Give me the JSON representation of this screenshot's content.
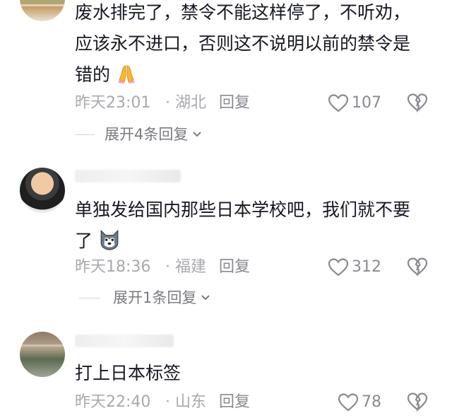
{
  "comments": [
    {
      "text_lines": [
        "废水排完了，禁令不能这样停了，不听劝，",
        "应该永不进口，否则这不说明以前的禁令是",
        "错的"
      ],
      "emoji": "folded-hands",
      "time": "昨天23:01",
      "location": "· 湖北",
      "reply_label": "回复",
      "likes": "107",
      "expand_label": "展开4条回复"
    },
    {
      "text_lines": [
        "单独发给国内那些日本学校吧，我们就不要",
        "了"
      ],
      "emoji": "husky-face",
      "time": "昨天18:36",
      "location": "· 福建",
      "reply_label": "回复",
      "likes": "312",
      "expand_label": "展开1条回复"
    },
    {
      "text_lines": [
        "打上日本标签"
      ],
      "time": "昨天22:40",
      "location": "· 山东",
      "reply_label": "回复",
      "likes": "78"
    }
  ],
  "colors": {
    "text": "#161823",
    "meta": "#a8a9ae",
    "action": "#8a8b91"
  }
}
